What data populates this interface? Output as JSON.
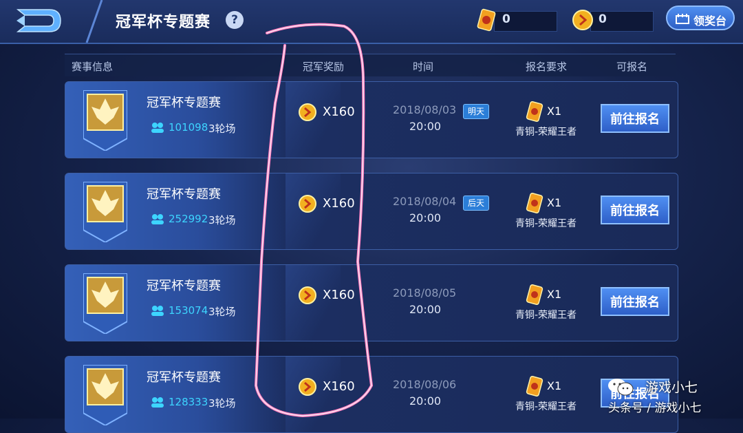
{
  "header": {
    "title": "冠军杯专题赛",
    "help_label": "?",
    "currency": [
      {
        "icon": "gold-ticket-icon",
        "value": "0"
      },
      {
        "icon": "gold-coin-icon",
        "value": "0"
      }
    ],
    "award_button_label": "领奖台"
  },
  "columns": [
    "赛事信息",
    "冠军奖励",
    "时间",
    "报名要求",
    "可报名"
  ],
  "rows": [
    {
      "name": "冠军杯专题赛",
      "players": "101098",
      "rounds": "3轮场",
      "reward": "X160",
      "date": "2018/08/03",
      "time": "20:00",
      "tag": "明天",
      "ticket": "X1",
      "requirement": "青铜-荣耀王者",
      "button": "前往报名"
    },
    {
      "name": "冠军杯专题赛",
      "players": "252992",
      "rounds": "3轮场",
      "reward": "X160",
      "date": "2018/08/04",
      "time": "20:00",
      "tag": "后天",
      "ticket": "X1",
      "requirement": "青铜-荣耀王者",
      "button": "前往报名"
    },
    {
      "name": "冠军杯专题赛",
      "players": "153074",
      "rounds": "3轮场",
      "reward": "X160",
      "date": "2018/08/05",
      "time": "20:00",
      "tag": "",
      "ticket": "X1",
      "requirement": "青铜-荣耀王者",
      "button": "前往报名"
    },
    {
      "name": "冠军杯专题赛",
      "players": "128333",
      "rounds": "3轮场",
      "reward": "X160",
      "date": "2018/08/06",
      "time": "20:00",
      "tag": "",
      "ticket": "X1",
      "requirement": "青铜-荣耀王者",
      "button": "前往报名"
    }
  ],
  "watermark": {
    "name": "游戏小七",
    "source": "头条号 / 游戏小七"
  },
  "colors": {
    "accent": "#3dd5ff",
    "highlight": "#ff6fb0",
    "button": "#2e5fc8"
  }
}
